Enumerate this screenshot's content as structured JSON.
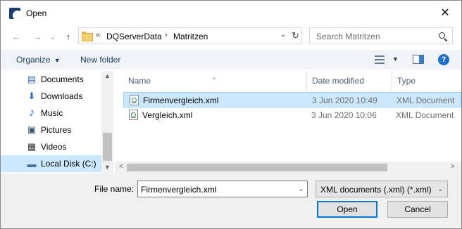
{
  "window": {
    "title": "Open",
    "close_glyph": "✕"
  },
  "nav": {
    "back_glyph": "←",
    "forward_glyph": "→",
    "recent_glyph": "⌄",
    "up_glyph": "↑"
  },
  "address": {
    "overflow": "«",
    "crumbs": [
      "DQServerData",
      "Matritzen"
    ],
    "separator": "›",
    "dropdown_glyph": "⌄",
    "refresh_glyph": "↻"
  },
  "search": {
    "placeholder": "Search Matritzen"
  },
  "commands": {
    "organize": "Organize",
    "organize_caret": "▼",
    "new_folder": "New folder",
    "view_caret": "▼",
    "help": "?"
  },
  "sidebar": {
    "items": [
      {
        "label": "Documents",
        "icon": "documents-icon",
        "glyph": "▤"
      },
      {
        "label": "Downloads",
        "icon": "downloads-icon",
        "glyph": "⬇"
      },
      {
        "label": "Music",
        "icon": "music-icon",
        "glyph": "♪"
      },
      {
        "label": "Pictures",
        "icon": "pictures-icon",
        "glyph": "▣"
      },
      {
        "label": "Videos",
        "icon": "videos-icon",
        "glyph": "▦"
      },
      {
        "label": "Local Disk (C:)",
        "icon": "local-disk-icon",
        "glyph": "▬",
        "selected": true
      }
    ],
    "scroll_up": "▲",
    "scroll_down": "▼"
  },
  "files": {
    "columns": {
      "name": "Name",
      "date": "Date modified",
      "type": "Type",
      "sort_glyph": "^"
    },
    "rows": [
      {
        "name": "Firmenvergleich.xml",
        "date": "3 Jun 2020 10:49",
        "type": "XML Document",
        "selected": true
      },
      {
        "name": "Vergleich.xml",
        "date": "3 Jun 2020 10:06",
        "type": "XML Document",
        "selected": false
      }
    ],
    "scroll_left": "<",
    "scroll_right": ">"
  },
  "footer": {
    "file_name_label": "File name:",
    "file_name_value": "Firmenvergleich.xml",
    "file_name_dd": "⌄",
    "filter_value": "XML documents (.xml) (*.xml)",
    "filter_dd": "⌄",
    "open_label": "Open",
    "cancel_label": "Cancel"
  },
  "colors": {
    "accent": "#0078d7",
    "selection": "#cce8ff",
    "command_bar": "#f0f4f9",
    "footer": "#f0f0f0"
  }
}
